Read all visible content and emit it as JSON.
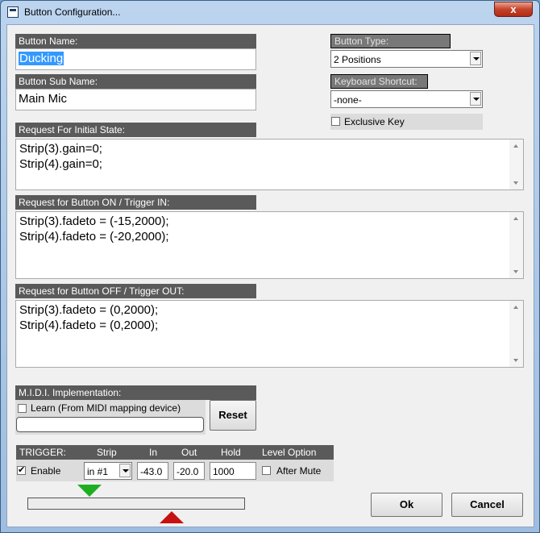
{
  "window": {
    "title": "Button Configuration...",
    "close_label": "x"
  },
  "button_name": {
    "label": "Button Name:",
    "value": "Ducking"
  },
  "button_sub_name": {
    "label": "Button Sub Name:",
    "value": "Main Mic"
  },
  "button_type": {
    "label": "Button Type:",
    "value": "2 Positions"
  },
  "keyboard_shortcut": {
    "label": "Keyboard Shortcut:",
    "value": "-none-"
  },
  "exclusive_key": {
    "label": "Exclusive Key",
    "checked": false
  },
  "initial_state": {
    "label": "Request For Initial State:",
    "lines": [
      "Strip(3).gain=0;",
      "Strip(4).gain=0;"
    ]
  },
  "button_on": {
    "label": "Request for Button ON / Trigger IN:",
    "lines": [
      "Strip(3).fadeto = (-15,2000);",
      "Strip(4).fadeto = (-20,2000);"
    ]
  },
  "button_off": {
    "label": "Request for Button OFF / Trigger OUT:",
    "lines": [
      "Strip(3).fadeto = (0,2000);",
      "Strip(4).fadeto = (0,2000);"
    ]
  },
  "midi": {
    "label": "M.I.D.I. Implementation:",
    "learn_label": "Learn (From MIDI mapping device)",
    "learn_checked": false,
    "value": "",
    "reset_label": "Reset"
  },
  "trigger": {
    "headers": {
      "trigger": "TRIGGER:",
      "strip": "Strip",
      "in": "In",
      "out": "Out",
      "hold": "Hold",
      "level_option": "Level Option"
    },
    "enable_label": "Enable",
    "enable_checked": true,
    "strip_value": "in #1",
    "in_value": "-43.0",
    "out_value": "-20.0",
    "hold_value": "1000",
    "after_mute_label": "After Mute",
    "after_mute_checked": false,
    "colors": {
      "in_marker": "#1fae22",
      "out_marker": "#c81111"
    }
  },
  "ok_label": "Ok",
  "cancel_label": "Cancel",
  "check_mark": "✔"
}
